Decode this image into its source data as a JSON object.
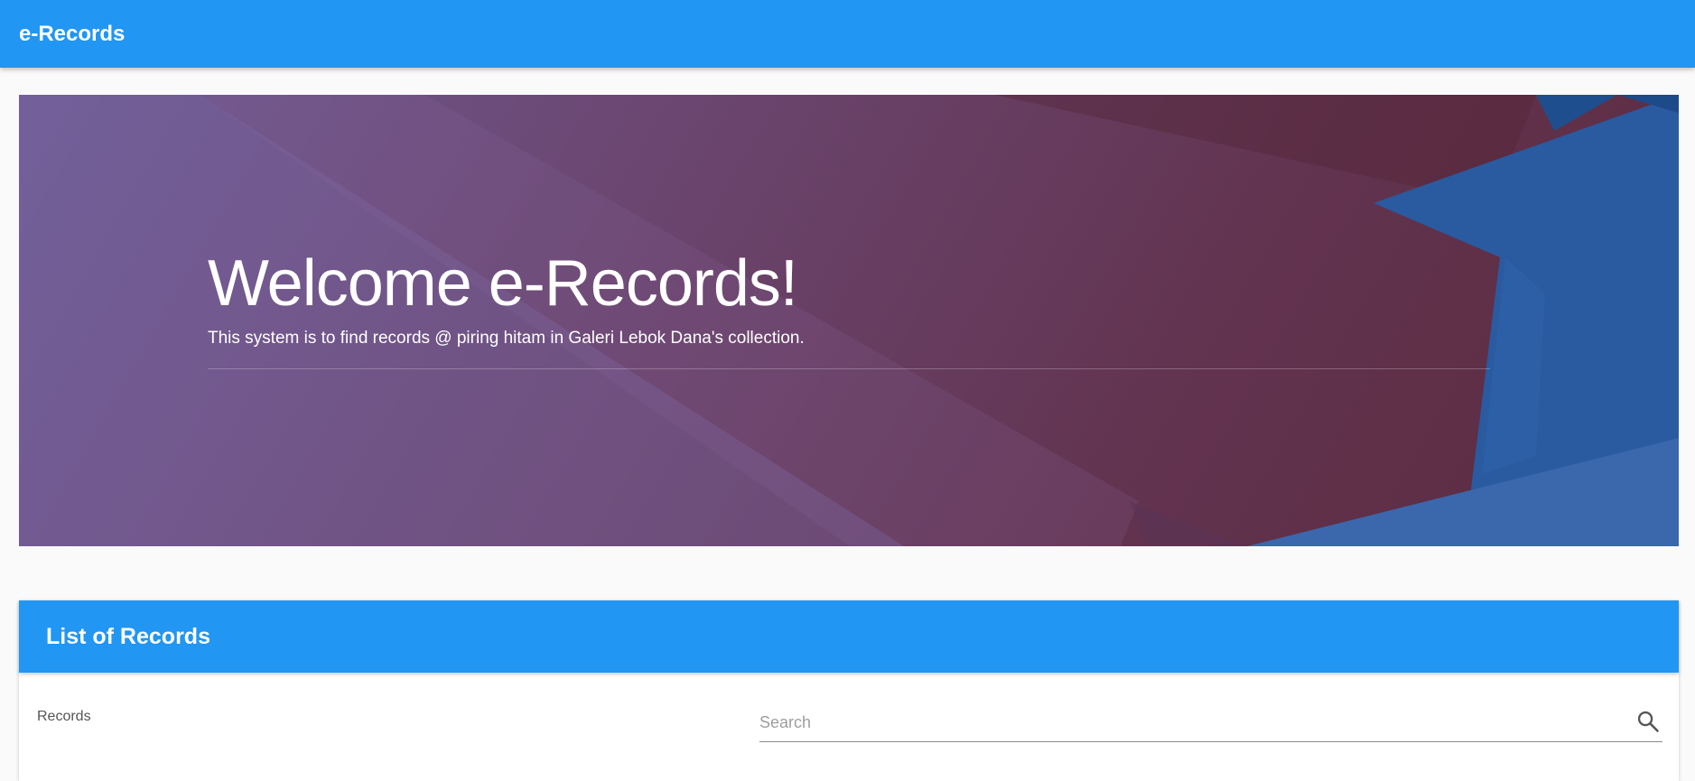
{
  "app": {
    "brand": "e-Records"
  },
  "hero": {
    "title": "Welcome e-Records!",
    "subtitle": "This system is to find records @ piring hitam in Galeri Lebok Dana's collection."
  },
  "records_card": {
    "title": "List of Records",
    "label": "Records",
    "search": {
      "placeholder": "Search",
      "value": "",
      "icon": "search-icon"
    }
  },
  "colors": {
    "primary": "#2196f3",
    "page_background": "#fafafa",
    "hero_purple": "#6f5b95",
    "hero_maroon": "#5b2b3e",
    "hero_blue": "#2a5aa0"
  }
}
